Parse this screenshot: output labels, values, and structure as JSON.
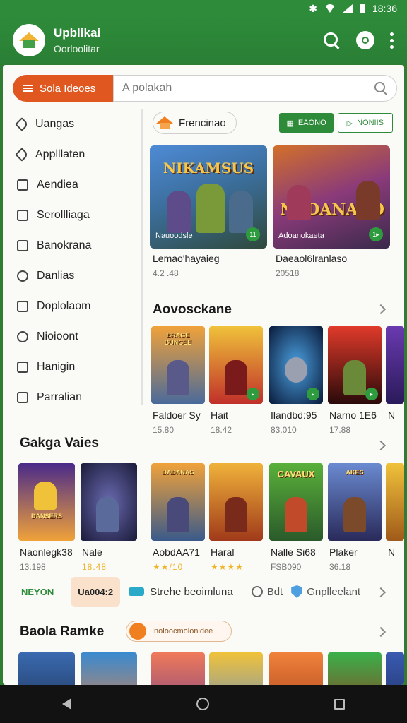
{
  "status": {
    "time": "18:36"
  },
  "app": {
    "title": "Upblikai",
    "subtitle": "Oorloolitar"
  },
  "search": {
    "category_label": "Sola Ideoes",
    "placeholder": "A polakah"
  },
  "sidebar": {
    "items": [
      {
        "label": "Uangas",
        "icon": "tag-icon"
      },
      {
        "label": "Applllaten",
        "icon": "pin-icon"
      },
      {
        "label": "Aendiea",
        "icon": "square-icon"
      },
      {
        "label": "Serollliaga",
        "icon": "list-icon"
      },
      {
        "label": "Banokrana",
        "icon": "bookmark-icon"
      },
      {
        "label": "Danlias",
        "icon": "drop-icon"
      },
      {
        "label": "Doplolaom",
        "icon": "doc-icon"
      },
      {
        "label": "Nioioont",
        "icon": "shield-icon"
      },
      {
        "label": "Hanigin",
        "icon": "check-square-icon"
      },
      {
        "label": "Parralian",
        "icon": "grid-icon"
      }
    ]
  },
  "featured": {
    "label": "Frencinao",
    "btn1": "EAONO",
    "btn2": "NONIIS",
    "cards": [
      {
        "title": "NIKAMSUS",
        "subtitle": "Nauoodsle",
        "badge": "11",
        "name": "Lemao'hayaieg",
        "meta": "4.2 .48"
      },
      {
        "title": "NADANARO",
        "subtitle": "Adoanokaeta",
        "badge": "1▸",
        "name": "Daeaol6lranlaso",
        "meta": "20518"
      }
    ]
  },
  "section1": {
    "title": "Aovosckane",
    "tiles": [
      {
        "title": "BRAGE BUNGEE",
        "name": "Faldoer Sy",
        "meta": "15.80"
      },
      {
        "title": "",
        "name": "Hait",
        "meta": "18.42"
      },
      {
        "title": "",
        "name": "Ilandbd:95",
        "meta": "83.010"
      },
      {
        "title": "",
        "name": "Narno 1E6",
        "meta": "17.88"
      },
      {
        "title": "",
        "name": "N",
        "meta": ""
      }
    ]
  },
  "section2": {
    "title": "Gakga Vaies",
    "tiles": [
      {
        "title": "DANSERS",
        "name": "Naonlegk38",
        "meta": "13.198"
      },
      {
        "title": "",
        "name": "Nale",
        "meta": "18.48"
      },
      {
        "title": "DADANAS",
        "name": "AobdAA71",
        "meta": "★★/10"
      },
      {
        "title": "",
        "name": "Haral",
        "meta": "★★★★"
      },
      {
        "title": "CAVAUX",
        "name": "Nalle Si68",
        "meta": "FSB090"
      },
      {
        "title": "AKES",
        "name": "Plaker",
        "meta": "36.18"
      },
      {
        "title": "",
        "name": "N",
        "meta": ""
      }
    ]
  },
  "chips": {
    "a": "NEYON",
    "b": "Ua004:2",
    "c": "Strehe beoimluna",
    "d": "Bdt",
    "e": "Gnplleelant"
  },
  "section3": {
    "title": "Baola Ramke",
    "pill": "Inoloocmolonidee"
  },
  "colors": {
    "brand_green": "#2e8b3a",
    "accent_orange": "#e0571f",
    "play_green": "#2e9b3f"
  }
}
